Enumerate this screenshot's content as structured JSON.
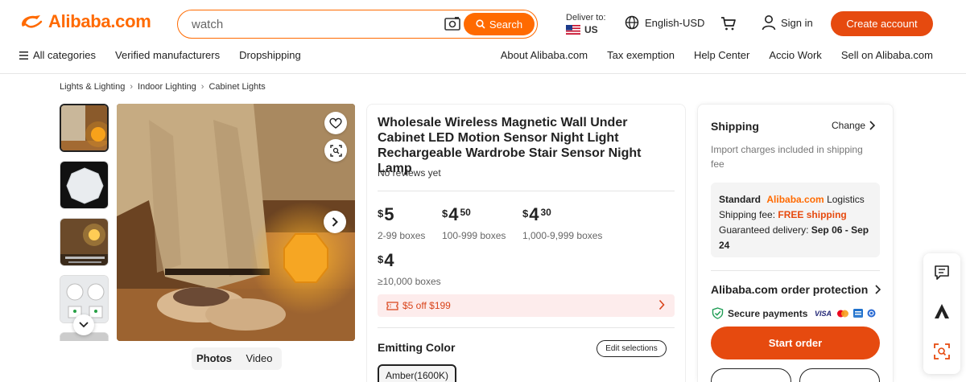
{
  "header": {
    "logo_text": "Alibaba.com",
    "search": {
      "value": "watch",
      "button_label": "Search"
    },
    "deliver": {
      "label": "Deliver to:",
      "country": "US"
    },
    "language": "English-USD",
    "sign_in": "Sign in",
    "create_account": "Create account",
    "nav_left": [
      "All categories",
      "Verified manufacturers",
      "Dropshipping"
    ],
    "nav_right": [
      "About Alibaba.com",
      "Tax exemption",
      "Help Center",
      "Accio Work",
      "Sell on Alibaba.com"
    ]
  },
  "breadcrumb": [
    "Lights & Lighting",
    "Indoor Lighting",
    "Cabinet Lights"
  ],
  "gallery": {
    "tabs": [
      "Photos",
      "Video"
    ],
    "active_tab": "Photos",
    "thumb_count": 5
  },
  "product": {
    "title": "Wholesale Wireless Magnetic Wall Under Cabinet LED Motion Sensor Night Light Rechargeable Wardrobe Stair Sensor Night Lamp",
    "reviews": "No reviews yet",
    "tiers": [
      {
        "currency": "$",
        "whole": "5",
        "cents": "",
        "range": "2-99 boxes"
      },
      {
        "currency": "$",
        "whole": "4",
        "cents": "50",
        "range": "100-999 boxes"
      },
      {
        "currency": "$",
        "whole": "4",
        "cents": "30",
        "range": "1,000-9,999 boxes"
      },
      {
        "currency": "$",
        "whole": "4",
        "cents": "",
        "range": "≥10,000 boxes"
      }
    ],
    "coupon": "$5 off $199",
    "variation_label": "Emitting Color",
    "edit_selections": "Edit selections",
    "selected_color": "Amber(1600K)"
  },
  "shipping": {
    "title": "Shipping",
    "change": "Change",
    "import_note": "Import charges included in shipping fee",
    "standard_label": "Standard",
    "logistics_brand": "Alibaba.com",
    "logistics_word": "Logistics",
    "fee_label": "Shipping fee:",
    "fee_value": "FREE shipping",
    "delivery_label": "Guaranteed delivery:",
    "delivery_value": "Sep 06 - Sep 24",
    "protection": "Alibaba.com order protection",
    "secure_payments": "Secure payments",
    "start_order": "Start order"
  },
  "colors": {
    "brand_orange": "#ff6a00",
    "cta_red": "#e64a0f",
    "coupon_bg": "#fdecec"
  }
}
